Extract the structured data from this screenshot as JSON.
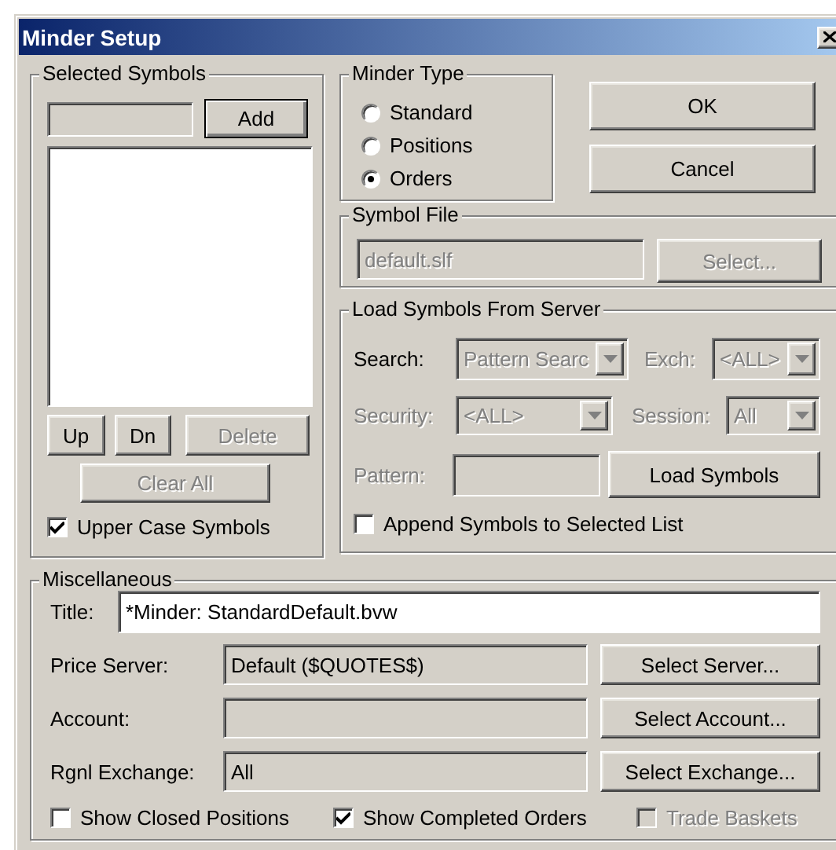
{
  "window": {
    "title": "Minder Setup"
  },
  "selected_symbols": {
    "title": "Selected Symbols",
    "add_button": {
      "label": "Add",
      "disabled": false
    },
    "move_buttons": [
      {
        "label": "Up",
        "disabled": false
      },
      {
        "label": "Dn",
        "disabled": false
      },
      {
        "label": "Delete",
        "disabled": true
      }
    ],
    "clear_all": {
      "label": "Clear All",
      "disabled": true
    },
    "upper_case": {
      "label": "Upper Case Symbols",
      "checked": true
    }
  },
  "minder_type": {
    "title": "Minder Type",
    "options": [
      {
        "label": "Standard",
        "selected": false
      },
      {
        "label": "Positions",
        "selected": false
      },
      {
        "label": "Orders",
        "selected": true
      }
    ]
  },
  "dialog_buttons": [
    {
      "label": "OK"
    },
    {
      "label": "Cancel"
    }
  ],
  "symbol_file": {
    "title": "Symbol File",
    "field": {
      "value": "default.slf",
      "disabled": true
    },
    "button": {
      "label": "Select...",
      "disabled": true
    }
  },
  "load_symbols": {
    "title": "Load Symbols From Server",
    "search": {
      "label": "Search:",
      "label_disabled": false,
      "value": "Pattern Searc",
      "disabled": true
    },
    "exch": {
      "label": "Exch:",
      "label_disabled": true,
      "value": "<ALL>",
      "disabled": true
    },
    "security": {
      "label": "Security:",
      "label_disabled": true,
      "value": "<ALL>",
      "disabled": true
    },
    "session": {
      "label": "Session:",
      "label_disabled": true,
      "value": "All",
      "disabled": true
    },
    "pattern": {
      "label": "Pattern:",
      "label_disabled": true,
      "disabled": true
    },
    "button": {
      "label": "Load Symbols",
      "disabled": false
    },
    "append": {
      "label": "Append Symbols to Selected List",
      "checked": false
    }
  },
  "miscellaneous": {
    "title": "Miscellaneous",
    "title_field": {
      "label": "Title:",
      "value": "*Minder: StandardDefault.bvw"
    },
    "rows": [
      {
        "label": "Price Server:",
        "value": "Default ($QUOTES$)",
        "button": "Select Server..."
      },
      {
        "label": "Account:",
        "button": "Select Account..."
      },
      {
        "label": "Rgnl Exchange:",
        "value": "All",
        "button": "Select Exchange..."
      }
    ],
    "checks": [
      {
        "label": "Show Closed Positions",
        "checked": false,
        "disabled": false
      },
      {
        "label": "Show Completed Orders",
        "checked": true,
        "disabled": false
      },
      {
        "label": "Trade Baskets",
        "checked": false,
        "disabled": true
      }
    ]
  }
}
